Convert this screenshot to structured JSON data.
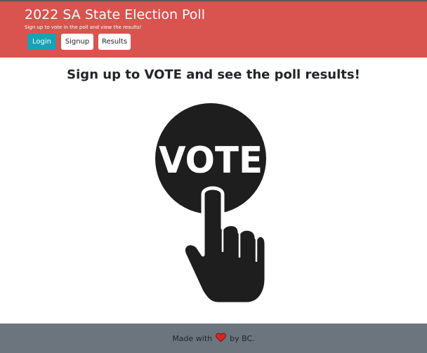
{
  "header": {
    "title": "2022 SA State Election Poll",
    "subtitle": "Sign up to vote in the poll and view the results!",
    "background_color": "#d9534f",
    "nav": {
      "login_label": "Login",
      "signup_label": "Signup",
      "results_label": "Results",
      "login_color": "#17a2b8"
    }
  },
  "main": {
    "headline": "Sign up to VOTE and see the poll results!",
    "graphic": {
      "icon": "vote-hand-icon",
      "text": "VOTE"
    }
  },
  "footer": {
    "made_with": "Made with",
    "heart_icon": "heart-icon",
    "heart_color": "#e02020",
    "by": "by BC.",
    "background_color": "#6c757d"
  }
}
